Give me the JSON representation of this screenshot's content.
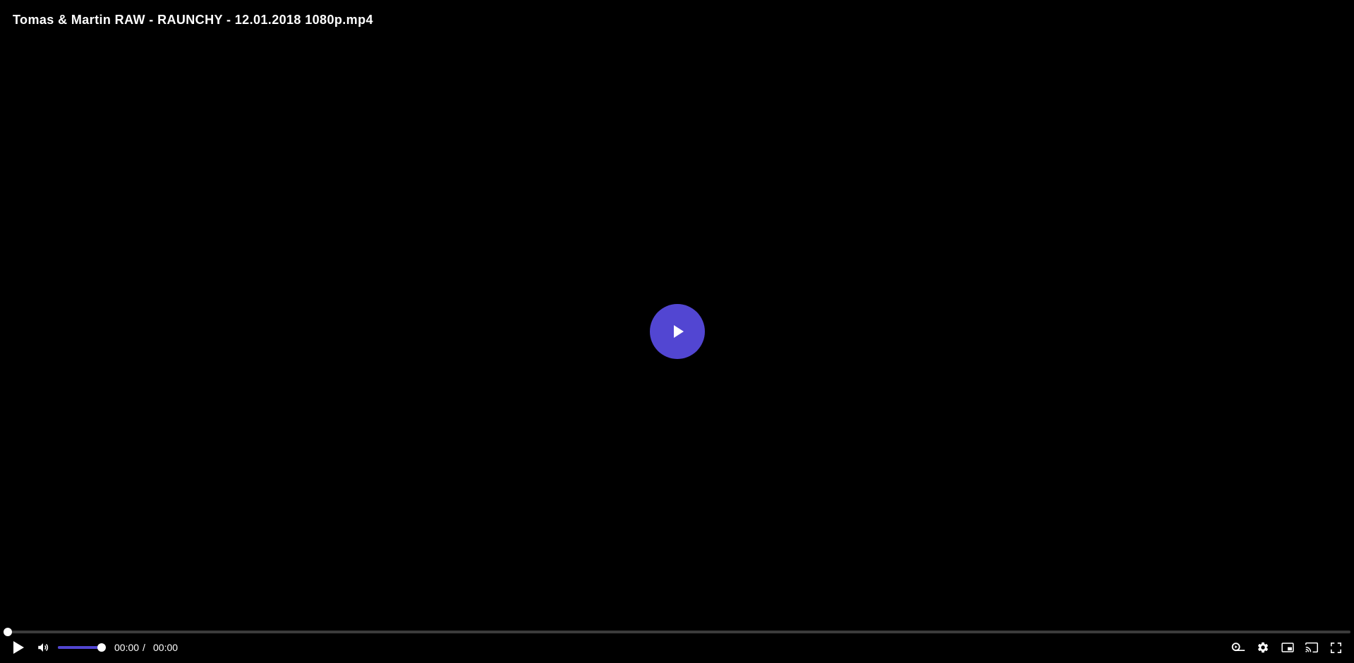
{
  "video": {
    "title": "Tomas & Martin RAW - RAUNCHY - 12.01.2018 1080p.mp4"
  },
  "playback": {
    "current_time": "00:00",
    "separator": "/",
    "duration": "00:00",
    "progress_fraction": 0
  },
  "volume": {
    "level_fraction": 1
  },
  "colors": {
    "accent": "#5246d2",
    "background": "#000000",
    "track": "#3b3b3b",
    "text": "#ffffff"
  },
  "icons": {
    "big_play": "play-icon",
    "play": "play-icon",
    "volume": "volume-icon",
    "speed": "playback-speed-icon",
    "settings": "gear-icon",
    "pip": "picture-in-picture-icon",
    "cast": "cast-icon",
    "fullscreen": "fullscreen-icon"
  }
}
